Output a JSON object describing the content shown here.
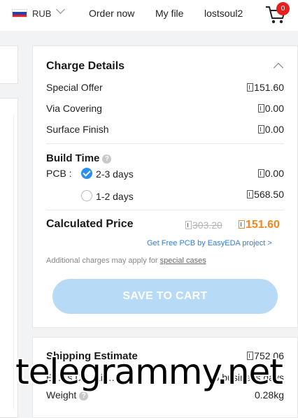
{
  "header": {
    "currency": "RUB",
    "nav": [
      "Order now",
      "My file",
      "lostsoul2"
    ],
    "cart_count": "0",
    "colors": {
      "badge": "#e61e1e"
    }
  },
  "charge": {
    "title": "Charge Details",
    "rows": [
      {
        "label": "Special Offer",
        "value": "151.60"
      },
      {
        "label": "Via Covering",
        "value": "0.00"
      },
      {
        "label": "Surface Finish",
        "value": "0.00"
      }
    ],
    "build_time": {
      "title": "Build Time",
      "pcb_label": "PCB :",
      "options": [
        {
          "label": "2-3 days",
          "value": "0.00",
          "selected": true
        },
        {
          "label": "1-2 days",
          "value": "568.50",
          "selected": false
        }
      ]
    },
    "calculated": {
      "label": "Calculated Price",
      "old_price": "303.20",
      "new_price": "151.60"
    },
    "free_link": "Get Free PCB by EasyEDA project >",
    "note_prefix": "Additional charges may apply for ",
    "note_link": "special cases",
    "save_button": "SAVE TO CART",
    "colors": {
      "accent": "#f5861f",
      "link": "#2f7de1",
      "button": "#b7dbf7",
      "radio": "#2a8ff0"
    }
  },
  "shipping": {
    "title": "Shipping Estimate",
    "value": "752.06",
    "delivery_partial": "Ex…s Dr…Lin…",
    "delivery_time": "5 business days",
    "weight_label": "Weight",
    "weight_value": "0.28kg"
  },
  "watermark": "telegrammy.net"
}
